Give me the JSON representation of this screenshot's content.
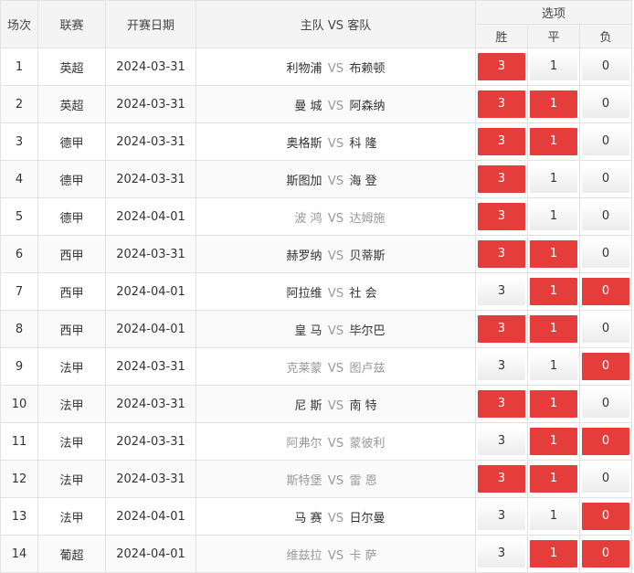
{
  "header": {
    "round": "场次",
    "league": "联赛",
    "date": "开赛日期",
    "match": "主队 VS 客队",
    "options": "选项",
    "win": "胜",
    "draw": "平",
    "loss": "负"
  },
  "vs": "VS",
  "matches": [
    {
      "no": "1",
      "league": "英超",
      "date": "2024-03-31",
      "home": "利物浦",
      "away": "布赖顿",
      "muted": false,
      "w": "3",
      "d": "1",
      "l": "0",
      "sel": [
        true,
        false,
        false
      ]
    },
    {
      "no": "2",
      "league": "英超",
      "date": "2024-03-31",
      "home": "曼 城",
      "away": "阿森纳",
      "muted": false,
      "w": "3",
      "d": "1",
      "l": "0",
      "sel": [
        true,
        true,
        false
      ]
    },
    {
      "no": "3",
      "league": "德甲",
      "date": "2024-03-31",
      "home": "奥格斯",
      "away": "科 隆",
      "muted": false,
      "w": "3",
      "d": "1",
      "l": "0",
      "sel": [
        true,
        true,
        false
      ]
    },
    {
      "no": "4",
      "league": "德甲",
      "date": "2024-03-31",
      "home": "斯图加",
      "away": "海 登",
      "muted": false,
      "w": "3",
      "d": "1",
      "l": "0",
      "sel": [
        true,
        false,
        false
      ]
    },
    {
      "no": "5",
      "league": "德甲",
      "date": "2024-04-01",
      "home": "波 鸿",
      "away": "达姆施",
      "muted": true,
      "w": "3",
      "d": "1",
      "l": "0",
      "sel": [
        true,
        false,
        false
      ]
    },
    {
      "no": "6",
      "league": "西甲",
      "date": "2024-03-31",
      "home": "赫罗纳",
      "away": "贝蒂斯",
      "muted": false,
      "w": "3",
      "d": "1",
      "l": "0",
      "sel": [
        true,
        true,
        false
      ]
    },
    {
      "no": "7",
      "league": "西甲",
      "date": "2024-04-01",
      "home": "阿拉维",
      "away": "社 会",
      "muted": false,
      "w": "3",
      "d": "1",
      "l": "0",
      "sel": [
        false,
        true,
        true
      ]
    },
    {
      "no": "8",
      "league": "西甲",
      "date": "2024-04-01",
      "home": "皇 马",
      "away": "毕尔巴",
      "muted": false,
      "w": "3",
      "d": "1",
      "l": "0",
      "sel": [
        true,
        true,
        false
      ]
    },
    {
      "no": "9",
      "league": "法甲",
      "date": "2024-03-31",
      "home": "克莱蒙",
      "away": "图卢兹",
      "muted": true,
      "w": "3",
      "d": "1",
      "l": "0",
      "sel": [
        false,
        false,
        true
      ]
    },
    {
      "no": "10",
      "league": "法甲",
      "date": "2024-03-31",
      "home": "尼 斯",
      "away": "南 特",
      "muted": false,
      "w": "3",
      "d": "1",
      "l": "0",
      "sel": [
        true,
        true,
        false
      ]
    },
    {
      "no": "11",
      "league": "法甲",
      "date": "2024-03-31",
      "home": "阿弗尔",
      "away": "蒙彼利",
      "muted": true,
      "w": "3",
      "d": "1",
      "l": "0",
      "sel": [
        false,
        true,
        true
      ]
    },
    {
      "no": "12",
      "league": "法甲",
      "date": "2024-03-31",
      "home": "斯特堡",
      "away": "雷 恩",
      "muted": true,
      "w": "3",
      "d": "1",
      "l": "0",
      "sel": [
        true,
        true,
        false
      ]
    },
    {
      "no": "13",
      "league": "法甲",
      "date": "2024-04-01",
      "home": "马 赛",
      "away": "日尔曼",
      "muted": false,
      "w": "3",
      "d": "1",
      "l": "0",
      "sel": [
        false,
        false,
        true
      ]
    },
    {
      "no": "14",
      "league": "葡超",
      "date": "2024-04-01",
      "home": "维兹拉",
      "away": "卡 萨",
      "muted": true,
      "w": "3",
      "d": "1",
      "l": "0",
      "sel": [
        false,
        true,
        true
      ]
    }
  ],
  "colors": {
    "selected": "#e53c3c",
    "muted_text": "#999999"
  }
}
